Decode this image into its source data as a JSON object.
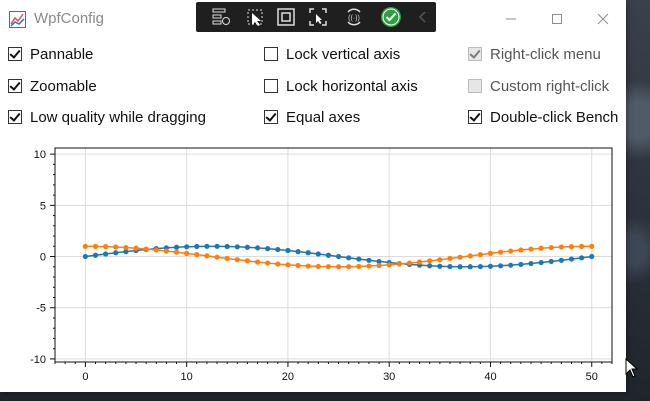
{
  "window": {
    "title": "WpfConfig"
  },
  "options": [
    {
      "label": "Pannable",
      "checked": true,
      "disabled": false
    },
    {
      "label": "Lock vertical axis",
      "checked": false,
      "disabled": false
    },
    {
      "label": "Right-click menu",
      "checked": true,
      "disabled": true
    },
    {
      "label": "Zoomable",
      "checked": true,
      "disabled": false
    },
    {
      "label": "Lock horizontal axis",
      "checked": false,
      "disabled": false
    },
    {
      "label": "Custom right-click",
      "checked": false,
      "disabled": true
    },
    {
      "label": "Low quality while dragging",
      "checked": true,
      "disabled": false
    },
    {
      "label": "Equal axes",
      "checked": true,
      "disabled": false
    },
    {
      "label": "Double-click Bench",
      "checked": true,
      "disabled": false
    }
  ],
  "chart_data": {
    "type": "scatter",
    "x_ticks": [
      "0",
      "10",
      "20",
      "30",
      "40",
      "50"
    ],
    "y_ticks": [
      "10",
      "5",
      "0",
      "-5",
      "-10"
    ],
    "xlim": [
      -3,
      52
    ],
    "ylim": [
      -10.3,
      10.6
    ],
    "grid": true,
    "colors": {
      "sin": "#1f77b4",
      "cos": "#ff7f0e"
    },
    "series": [
      {
        "function": "sin",
        "x_start": 0,
        "x_end": 50,
        "step": 1,
        "period": 50,
        "amplitude": 1
      },
      {
        "function": "cos",
        "x_start": 0,
        "x_end": 50,
        "step": 1,
        "period": 50,
        "amplitude": 1
      }
    ]
  }
}
